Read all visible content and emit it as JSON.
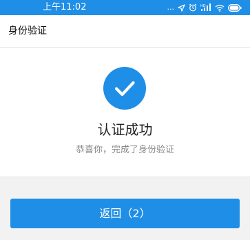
{
  "status_bar": {
    "time": "上午11:02",
    "icons": [
      "more-dots-icon",
      "location-icon",
      "alarm-icon",
      "signal-hd-icon",
      "wifi-icon",
      "battery-icon"
    ],
    "dots": "..."
  },
  "header": {
    "title": "身份验证"
  },
  "result": {
    "icon": "check-circle-icon",
    "title": "认证成功",
    "description": "恭喜你，完成了身份验证"
  },
  "actions": {
    "back_label": "返回（2）"
  },
  "colors": {
    "accent": "#1f8ee6",
    "background": "#f2f2f2"
  }
}
